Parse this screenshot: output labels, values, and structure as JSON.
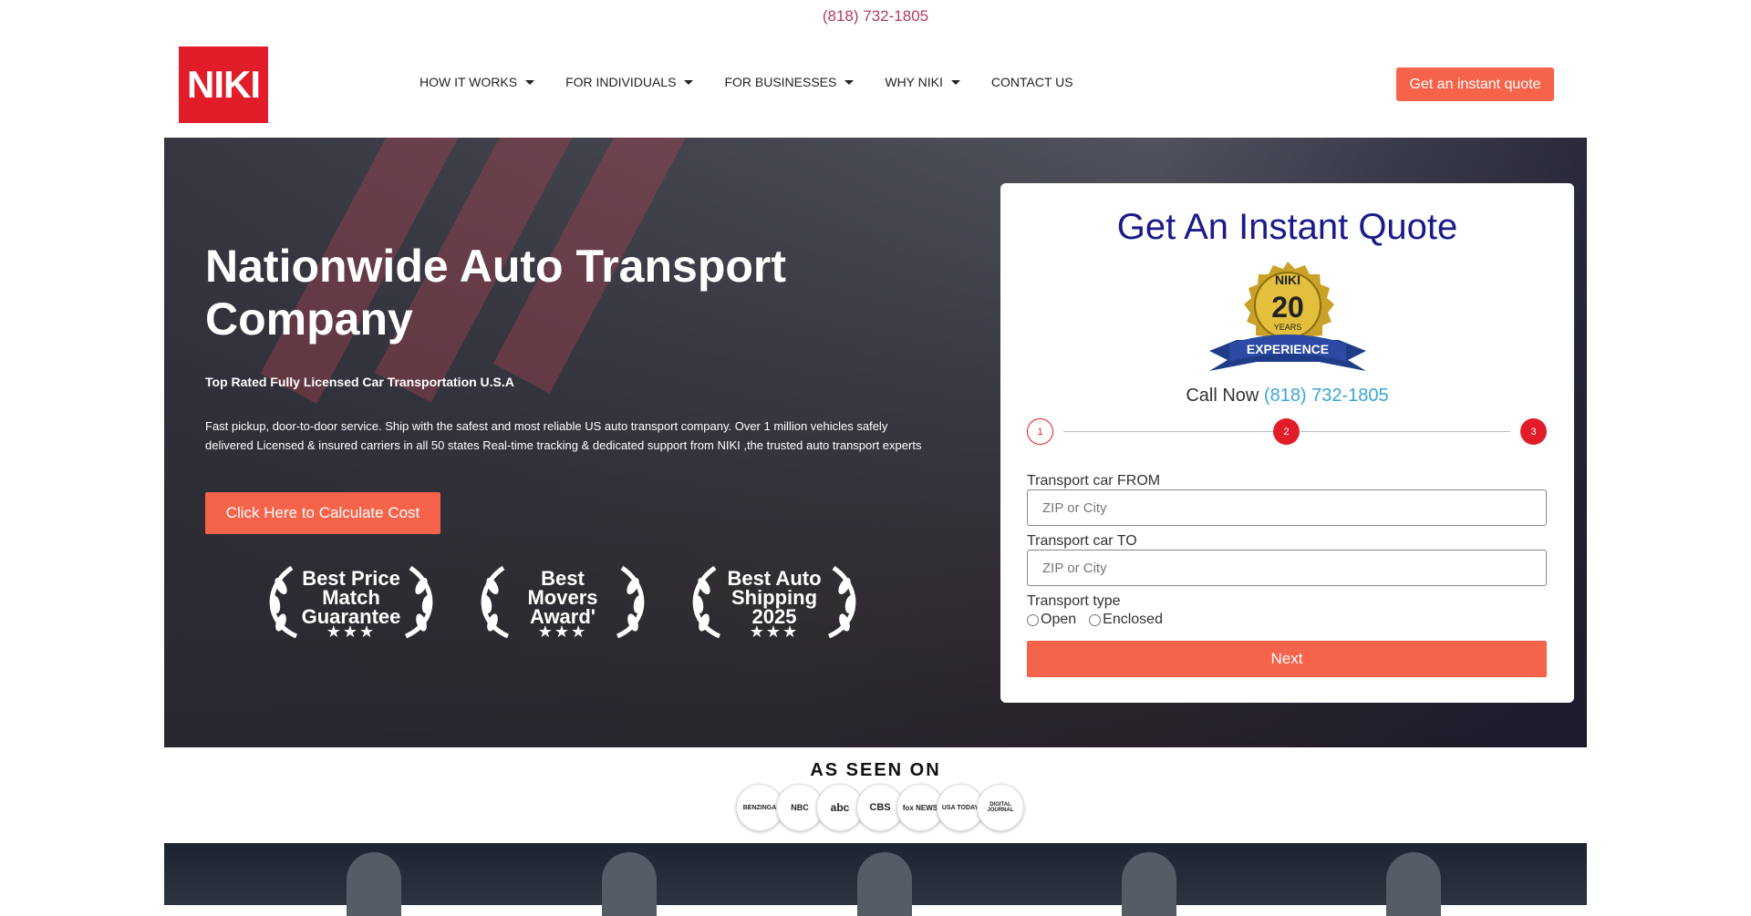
{
  "topbar": {
    "phone": "(818) 732-1805"
  },
  "header": {
    "logo_text": "NIKI",
    "nav": [
      {
        "label": "HOW IT WORKS",
        "has_dropdown": true
      },
      {
        "label": "FOR INDIVIDUALS",
        "has_dropdown": true
      },
      {
        "label": "FOR BUSINESSES",
        "has_dropdown": true
      },
      {
        "label": "WHY NIKI",
        "has_dropdown": true
      },
      {
        "label": "CONTACT US",
        "has_dropdown": false
      }
    ],
    "cta_label": "Get an instant quote"
  },
  "hero": {
    "title": "Nationwide Auto Transport Company",
    "subtitle": "Top Rated Fully Licensed Car Transportation U.S.A",
    "description": "Fast pickup, door-to-door service. Ship with the safest and most reliable US auto transport company. Over 1 million vehicles safely delivered Licensed & insured carriers in all 50 states Real-time tracking & dedicated support from NIKI ,the trusted auto transport experts",
    "cta_label": "Click Here to Calculate Cost",
    "awards": [
      {
        "text": "Best Price Match Guarantee",
        "stars": "★★★"
      },
      {
        "text": "Best Movers Award'",
        "stars": "★★★"
      },
      {
        "text": "Best Auto Shipping 2025",
        "stars": "★★★"
      }
    ]
  },
  "quote": {
    "title": "Get An Instant Quote",
    "badge": {
      "top": "NIKI",
      "number": "20",
      "years": "YEARS",
      "ribbon": "EXPERIENCE"
    },
    "call_label": "Call Now",
    "call_phone": "(818) 732-1805",
    "steps": [
      "1",
      "2",
      "3"
    ],
    "from_label": "Transport car FROM",
    "from_placeholder": "ZIP or City",
    "to_label": "Transport car TO",
    "to_placeholder": "ZIP or City",
    "type_label": "Transport type",
    "type_options": [
      "Open",
      "Enclosed"
    ],
    "next_label": "Next"
  },
  "as_seen_on": {
    "heading": "AS SEEN ON",
    "logos": [
      "BENZINGA",
      "NBC",
      "abc",
      "CBS",
      "fox NEWS",
      "USA TODAY",
      "DIGITAL JOURNAL"
    ]
  },
  "colors": {
    "accent": "#f5634a",
    "brand_red": "#e11d2a",
    "quote_title": "#1a1a8a",
    "phone_link": "#3aa4d8"
  }
}
